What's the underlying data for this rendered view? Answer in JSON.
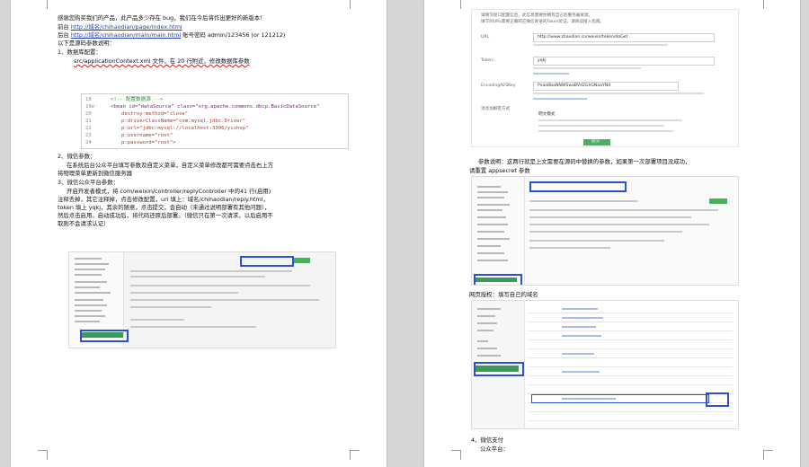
{
  "left_page": {
    "lines": [
      "感谢您购买我们的产品，此产品多少存在 bug，我们在今后将作出更好的新版本！",
      "以下是源码参数说明：",
      "1、数据库配置：",
      "2、微信参数：",
      "在系统后台公众平台填写参数及自定义菜单，自定义菜单修改都可需要点击右上方",
      "将物理菜单更新到微信服务器",
      "3、微信公众平台参数：",
      "开启开发者模式，将 com/weixin/controller/replyController 中的41 行(启用)",
      "注释去掉，其它注释掉，点击修改配置，url 填上：域名/chihaodian/reply.html，",
      "token 填上 yqkj，其余的随意，点击提交，会自动（未通过说明部署有其他问题），",
      "然后点击启用，启动成功后，将代码还原后部署。（微信只在第一次请求，以后启用不",
      "取则不会请求认证）"
    ],
    "front": {
      "label": "前台",
      "url": "http://域名/chihaodian/page/index.html"
    },
    "back": {
      "label": "后台",
      "url": "http://域名/chihaodian/main/main.html",
      "account": "账号密码 admin/123456 (or 121212)"
    },
    "config_line": "src/applicationContext.xml 文件，在 20 行附近，修改数据库参数",
    "code": [
      {
        "ln": "18",
        "text": "<!-- 配置数据源 -->"
      },
      {
        "ln": "19⊖",
        "text": "<bean id=\"dataSource\" class=\"org.apache.commons.dbcp.BasicDataSource\""
      },
      {
        "ln": "20",
        "text": "destroy-method=\"close\""
      },
      {
        "ln": "21",
        "text": "p:driverClassName=\"com.mysql.jdbc.Driver\""
      },
      {
        "ln": "22",
        "text": "p:url=\"jdbc:mysql://localhost:3306/yishop\""
      },
      {
        "ln": "23",
        "text": "p:username=\"root\""
      },
      {
        "ln": "24",
        "text": "p:password=\"root\">"
      }
    ]
  },
  "right_page": {
    "top_hint": "请填写接口配置信息，此信息需要你拥有自己的服务器资源。",
    "top_hint2": "填写的URL需要正确响应微信发送的Token验证，请阅读接入指南。",
    "form": [
      {
        "label": "URL",
        "value": "http://www.zhaodian.cn/weixin/token/doGet"
      },
      {
        "label": "Token",
        "value": "yqkj"
      },
      {
        "label": "EncodingAESKey",
        "value": "PxaoBbaNNWSwaBVd2GhGNaaYNd"
      },
      {
        "label": "消息加解密方式",
        "value": "明文模式"
      }
    ],
    "submit": "提交",
    "note1": "参数说明：这两行就是上文需要在源码中替换的参数，如果第一次部署项目没成功，",
    "note2": "请重置 appsecret 参数",
    "section_oauth": "网页授权：填写自己的域名",
    "section_pay": "4、微信支付",
    "section_pay_sub": "公众平台："
  }
}
